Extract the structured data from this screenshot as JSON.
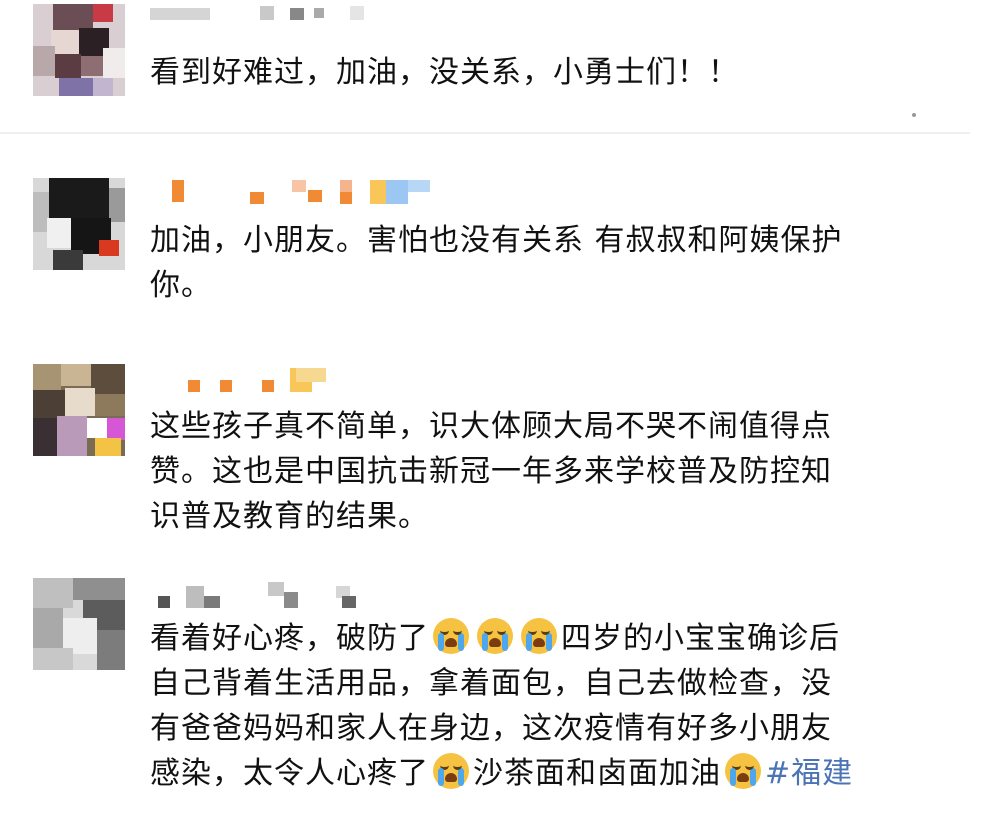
{
  "comments": [
    {
      "text": "看到好难过，加油，没关系，小勇士们！！"
    },
    {
      "text_line1": "加油，小朋友。害怕也没有关系 有叔叔和阿姨保护",
      "text_line2": "你。"
    },
    {
      "text_line1": "这些孩子真不简单，识大体顾大局不哭不闹值得点",
      "text_line2": "赞。这也是中国抗击新冠一年多来学校普及防控知",
      "text_line3": "识普及教育的结果。"
    },
    {
      "line1_a": "看着好心疼，破防了",
      "line1_b": "四岁的小宝宝确诊后",
      "line2": "自己背着生活用品，拿着面包，自己去做检查，没",
      "line3": "有爸爸妈妈和家人在身边，这次疫情有好多小朋友",
      "line4_a": "感染，太令人心疼了",
      "line4_b": "沙茶面和卤面加油",
      "hashtag": "#福建"
    }
  ],
  "icons": {
    "avatar": "pixelated-avatar",
    "emoji": "loudly-crying-face-emoji"
  },
  "colors": {
    "hashtag": "#4a74b6",
    "emoji_face": "#f6c241",
    "tear": "#4ea6ec"
  }
}
